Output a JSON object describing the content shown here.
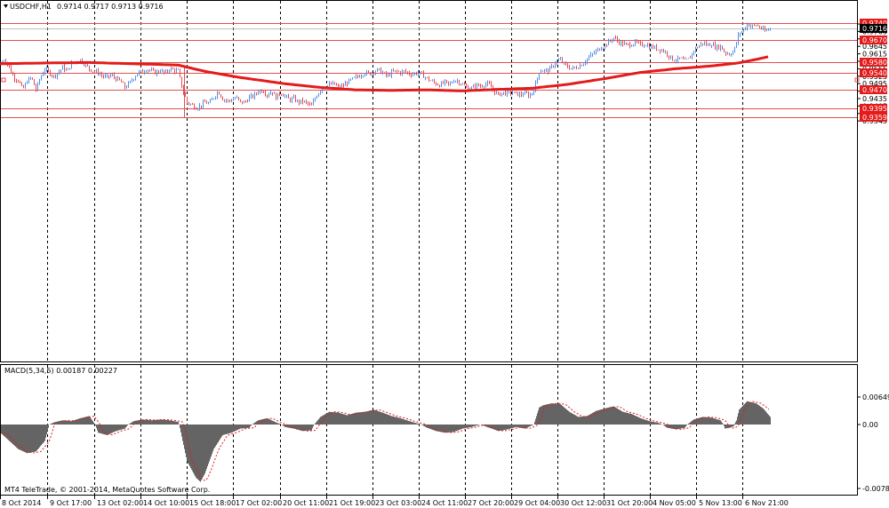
{
  "header": {
    "symbol": "USDCHF,H1",
    "ohlc": "0.9714 0.9717 0.9713 0.9716"
  },
  "colors": {
    "frame": "#000000",
    "grid": "#000000",
    "bull": "#4f8fe6",
    "bear": "#e44a52",
    "ma": "#e31b1b",
    "level": "#e05050",
    "macd_hist": "#646464",
    "macd_signal": "#e31b1b",
    "label_red": "#e31b1b",
    "label_black": "#000000"
  },
  "chart_data": [
    {
      "type": "candlestick",
      "title": "",
      "x_labels": [
        "8 Oct 2014",
        "9 Oct 17:00",
        "13 Oct 02:00",
        "14 Oct 10:00",
        "15 Oct 18:00",
        "17 Oct 02:00",
        "20 Oct 11:00",
        "21 Oct 19:00",
        "23 Oct 03:00",
        "24 Oct 11:00",
        "27 Oct 20:00",
        "29 Oct 04:00",
        "30 Oct 12:00",
        "31 Oct 20:00",
        "4 Nov 05:00",
        "5 Nov 13:00",
        "6 Nov 21:00"
      ],
      "y_ticks": [
        "0.9735",
        "0.9705",
        "0.9675",
        "0.9645",
        "0.9615",
        "0.9585",
        "0.9555",
        "0.9525",
        "0.9495",
        "0.9465",
        "0.9435",
        "0.9405",
        "0.9375",
        "0.9345"
      ],
      "ylim": [
        0.9337,
        0.9743
      ],
      "price_path": [
        [
          0,
          0.9575
        ],
        [
          5,
          0.9595
        ],
        [
          10,
          0.956
        ],
        [
          15,
          0.952
        ],
        [
          20,
          0.951
        ],
        [
          25,
          0.947
        ],
        [
          30,
          0.9505
        ],
        [
          35,
          0.952
        ],
        [
          40,
          0.947
        ],
        [
          45,
          0.952
        ],
        [
          50,
          0.9555
        ],
        [
          55,
          0.954
        ],
        [
          60,
          0.9525
        ],
        [
          65,
          0.954
        ],
        [
          70,
          0.956
        ],
        [
          75,
          0.9545
        ],
        [
          80,
          0.9575
        ],
        [
          85,
          0.9585
        ],
        [
          90,
          0.959
        ],
        [
          95,
          0.9575
        ],
        [
          100,
          0.9555
        ],
        [
          105,
          0.9545
        ],
        [
          110,
          0.954
        ],
        [
          115,
          0.9525
        ],
        [
          120,
          0.952
        ],
        [
          125,
          0.953
        ],
        [
          130,
          0.9515
        ],
        [
          135,
          0.9505
        ],
        [
          140,
          0.948
        ],
        [
          145,
          0.9495
        ],
        [
          150,
          0.952
        ],
        [
          155,
          0.954
        ],
        [
          160,
          0.9545
        ],
        [
          165,
          0.9555
        ],
        [
          170,
          0.9545
        ],
        [
          175,
          0.954
        ],
        [
          180,
          0.955
        ],
        [
          185,
          0.9535
        ],
        [
          190,
          0.9555
        ],
        [
          195,
          0.955
        ],
        [
          200,
          0.9545
        ],
        [
          205,
          0.947
        ],
        [
          210,
          0.942
        ],
        [
          215,
          0.941
        ],
        [
          220,
          0.94
        ],
        [
          225,
          0.9405
        ],
        [
          230,
          0.942
        ],
        [
          235,
          0.9415
        ],
        [
          240,
          0.944
        ],
        [
          245,
          0.9465
        ],
        [
          250,
          0.9435
        ],
        [
          255,
          0.9425
        ],
        [
          260,
          0.943
        ],
        [
          265,
          0.944
        ],
        [
          270,
          0.942
        ],
        [
          275,
          0.942
        ],
        [
          280,
          0.944
        ],
        [
          285,
          0.9445
        ],
        [
          290,
          0.9465
        ],
        [
          295,
          0.947
        ],
        [
          300,
          0.945
        ],
        [
          305,
          0.9465
        ],
        [
          310,
          0.944
        ],
        [
          315,
          0.946
        ],
        [
          320,
          0.9445
        ],
        [
          325,
          0.943
        ],
        [
          330,
          0.9435
        ],
        [
          335,
          0.942
        ],
        [
          340,
          0.9425
        ],
        [
          345,
          0.9415
        ],
        [
          350,
          0.9405
        ],
        [
          355,
          0.9445
        ],
        [
          360,
          0.947
        ],
        [
          365,
          0.9485
        ],
        [
          370,
          0.949
        ],
        [
          375,
          0.9495
        ],
        [
          380,
          0.948
        ],
        [
          385,
          0.9485
        ],
        [
          390,
          0.95
        ],
        [
          395,
          0.951
        ],
        [
          400,
          0.952
        ],
        [
          405,
          0.953
        ],
        [
          410,
          0.954
        ],
        [
          415,
          0.9535
        ],
        [
          420,
          0.9545
        ],
        [
          425,
          0.955
        ],
        [
          430,
          0.954
        ],
        [
          435,
          0.9525
        ],
        [
          440,
          0.954
        ],
        [
          445,
          0.9545
        ],
        [
          450,
          0.954
        ],
        [
          455,
          0.9545
        ],
        [
          460,
          0.9535
        ],
        [
          465,
          0.9535
        ],
        [
          470,
          0.954
        ],
        [
          475,
          0.953
        ],
        [
          480,
          0.9515
        ],
        [
          485,
          0.9505
        ],
        [
          490,
          0.9495
        ],
        [
          495,
          0.949
        ],
        [
          500,
          0.95
        ],
        [
          505,
          0.949
        ],
        [
          510,
          0.951
        ],
        [
          515,
          0.9505
        ],
        [
          520,
          0.949
        ],
        [
          525,
          0.948
        ],
        [
          530,
          0.9475
        ],
        [
          535,
          0.949
        ],
        [
          540,
          0.9485
        ],
        [
          545,
          0.9495
        ],
        [
          550,
          0.949
        ],
        [
          555,
          0.9465
        ],
        [
          560,
          0.945
        ],
        [
          565,
          0.946
        ],
        [
          570,
          0.9455
        ],
        [
          575,
          0.946
        ],
        [
          580,
          0.9455
        ],
        [
          585,
          0.945
        ],
        [
          590,
          0.946
        ],
        [
          595,
          0.9445
        ],
        [
          600,
          0.947
        ],
        [
          603,
          0.9505
        ],
        [
          606,
          0.9545
        ],
        [
          610,
          0.955
        ],
        [
          615,
          0.9545
        ],
        [
          620,
          0.956
        ],
        [
          625,
          0.9585
        ],
        [
          630,
          0.959
        ],
        [
          635,
          0.957
        ],
        [
          640,
          0.956
        ],
        [
          645,
          0.9555
        ],
        [
          650,
          0.9565
        ],
        [
          655,
          0.9575
        ],
        [
          660,
          0.9595
        ],
        [
          665,
          0.961
        ],
        [
          670,
          0.9625
        ],
        [
          675,
          0.964
        ],
        [
          680,
          0.965
        ],
        [
          685,
          0.9665
        ],
        [
          690,
          0.968
        ],
        [
          695,
          0.9665
        ],
        [
          700,
          0.9655
        ],
        [
          705,
          0.965
        ],
        [
          710,
          0.9655
        ],
        [
          715,
          0.966
        ],
        [
          720,
          0.965
        ],
        [
          725,
          0.9655
        ],
        [
          730,
          0.9645
        ],
        [
          735,
          0.964
        ],
        [
          740,
          0.9635
        ],
        [
          745,
          0.963
        ],
        [
          750,
          0.9615
        ],
        [
          755,
          0.9595
        ],
        [
          760,
          0.959
        ],
        [
          765,
          0.9595
        ],
        [
          770,
          0.9585
        ],
        [
          775,
          0.9595
        ],
        [
          780,
          0.963
        ],
        [
          785,
          0.9645
        ],
        [
          790,
          0.966
        ],
        [
          795,
          0.965
        ],
        [
          800,
          0.9655
        ],
        [
          805,
          0.964
        ],
        [
          810,
          0.9645
        ],
        [
          815,
          0.962
        ],
        [
          820,
          0.9615
        ],
        [
          825,
          0.9625
        ],
        [
          828,
          0.966
        ],
        [
          831,
          0.97
        ],
        [
          835,
          0.9705
        ],
        [
          840,
          0.9735
        ],
        [
          845,
          0.9725
        ],
        [
          850,
          0.973
        ],
        [
          855,
          0.972
        ],
        [
          860,
          0.9705
        ],
        [
          865,
          0.9716
        ]
      ],
      "moving_average": [
        [
          0,
          0.9575
        ],
        [
          50,
          0.9578
        ],
        [
          100,
          0.958
        ],
        [
          150,
          0.9575
        ],
        [
          200,
          0.957
        ],
        [
          230,
          0.9545
        ],
        [
          270,
          0.952
        ],
        [
          320,
          0.9495
        ],
        [
          360,
          0.948
        ],
        [
          400,
          0.947
        ],
        [
          440,
          0.9468
        ],
        [
          480,
          0.947
        ],
        [
          520,
          0.9466
        ],
        [
          560,
          0.9472
        ],
        [
          600,
          0.9477
        ],
        [
          640,
          0.9493
        ],
        [
          680,
          0.9515
        ],
        [
          720,
          0.954
        ],
        [
          760,
          0.9555
        ],
        [
          800,
          0.9566
        ],
        [
          830,
          0.9578
        ],
        [
          850,
          0.9592
        ],
        [
          866,
          0.9605
        ]
      ],
      "horizontal_levels": [
        {
          "value": 0.974,
          "label": "0.9740"
        },
        {
          "value": 0.967,
          "label": "0.9670"
        },
        {
          "value": 0.958,
          "label": "0.9580"
        },
        {
          "value": 0.954,
          "label": "0.9540"
        },
        {
          "value": 0.947,
          "label": "0.9470"
        },
        {
          "value": 0.9395,
          "label": "0.9395"
        },
        {
          "value": 0.9359,
          "label": "0.9359"
        }
      ],
      "bid_line": {
        "value": 0.9716,
        "label": "0.9716"
      }
    },
    {
      "type": "histogram",
      "indicator": "MACD(5,34,5) 0.00187 0.00227",
      "y_ticks": [
        "0.00649",
        "0.00",
        "-0.00781"
      ],
      "ylim": [
        -0.00781,
        0.00649
      ],
      "series": [
        [
          0,
          -0.001
        ],
        [
          10,
          -0.002
        ],
        [
          20,
          -0.003
        ],
        [
          30,
          -0.0035
        ],
        [
          40,
          -0.0033
        ],
        [
          50,
          -0.002
        ],
        [
          55,
          0.0
        ],
        [
          60,
          0.0005
        ],
        [
          70,
          0.001
        ],
        [
          80,
          0.0008
        ],
        [
          90,
          0.0015
        ],
        [
          100,
          0.002
        ],
        [
          105,
          0.0005
        ],
        [
          110,
          -0.001
        ],
        [
          120,
          -0.0013
        ],
        [
          130,
          -0.0008
        ],
        [
          140,
          -0.0005
        ],
        [
          150,
          0.0008
        ],
        [
          160,
          0.0012
        ],
        [
          170,
          0.001
        ],
        [
          180,
          0.0012
        ],
        [
          190,
          0.001
        ],
        [
          200,
          0.0006
        ],
        [
          205,
          -0.002
        ],
        [
          210,
          -0.0045
        ],
        [
          220,
          -0.0065
        ],
        [
          225,
          -0.007
        ],
        [
          230,
          -0.006
        ],
        [
          240,
          -0.003
        ],
        [
          250,
          -0.0013
        ],
        [
          260,
          -0.001
        ],
        [
          270,
          -0.0005
        ],
        [
          280,
          -0.0004
        ],
        [
          290,
          0.001
        ],
        [
          300,
          0.0015
        ],
        [
          310,
          0.0005
        ],
        [
          320,
          -0.0003
        ],
        [
          330,
          -0.0005
        ],
        [
          340,
          -0.0008
        ],
        [
          350,
          -0.0007
        ],
        [
          355,
          0.0005
        ],
        [
          360,
          0.0018
        ],
        [
          370,
          0.003
        ],
        [
          380,
          0.0028
        ],
        [
          390,
          0.0022
        ],
        [
          400,
          0.0028
        ],
        [
          410,
          0.003
        ],
        [
          420,
          0.0035
        ],
        [
          430,
          0.0028
        ],
        [
          440,
          0.002
        ],
        [
          450,
          0.0015
        ],
        [
          460,
          0.0008
        ],
        [
          470,
          0.0002
        ],
        [
          480,
          -0.0004
        ],
        [
          490,
          -0.0008
        ],
        [
          500,
          -0.001
        ],
        [
          510,
          -0.0009
        ],
        [
          520,
          -0.0005
        ],
        [
          530,
          -0.0003
        ],
        [
          540,
          0.0
        ],
        [
          550,
          -0.0004
        ],
        [
          560,
          -0.0008
        ],
        [
          570,
          -0.0006
        ],
        [
          580,
          -0.0003
        ],
        [
          590,
          -0.0005
        ],
        [
          600,
          0.0
        ],
        [
          603,
          0.002
        ],
        [
          606,
          0.004
        ],
        [
          610,
          0.0045
        ],
        [
          620,
          0.005
        ],
        [
          630,
          0.0048
        ],
        [
          640,
          0.003
        ],
        [
          650,
          0.0018
        ],
        [
          660,
          0.002
        ],
        [
          670,
          0.0032
        ],
        [
          680,
          0.0038
        ],
        [
          690,
          0.0043
        ],
        [
          700,
          0.003
        ],
        [
          710,
          0.0025
        ],
        [
          720,
          0.0015
        ],
        [
          730,
          0.0008
        ],
        [
          740,
          0.0004
        ],
        [
          750,
          -0.0004
        ],
        [
          760,
          -0.0006
        ],
        [
          770,
          -0.0004
        ],
        [
          780,
          0.0012
        ],
        [
          790,
          0.0018
        ],
        [
          800,
          0.0016
        ],
        [
          810,
          0.001
        ],
        [
          815,
          -0.0005
        ],
        [
          820,
          -0.0004
        ],
        [
          825,
          -0.0002
        ],
        [
          828,
          0.001
        ],
        [
          831,
          0.0035
        ],
        [
          840,
          0.0055
        ],
        [
          850,
          0.005
        ],
        [
          858,
          0.0038
        ],
        [
          866,
          0.0018
        ]
      ]
    }
  ],
  "footer": {
    "copyright": "MT4 TeleTrade, © 2001-2014, MetaQuotes Software Corp."
  }
}
